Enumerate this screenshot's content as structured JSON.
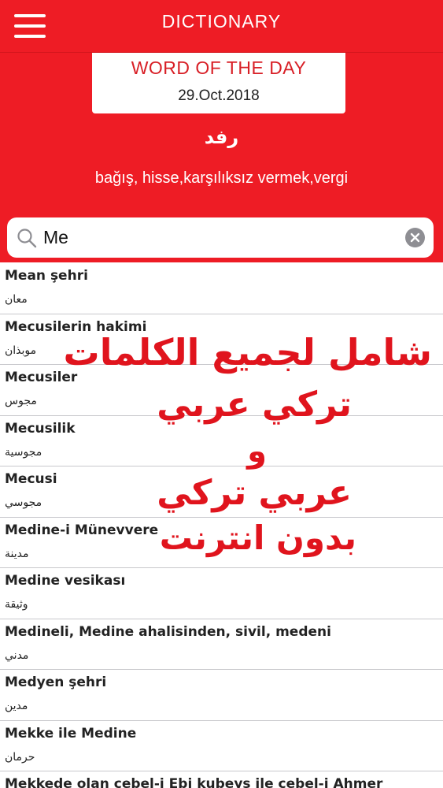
{
  "header": {
    "title": "DICTIONARY",
    "menu_icon": "hamburger-menu-icon",
    "background_color": "#ee1c25"
  },
  "word_of_the_day": {
    "heading": "WORD OF THE DAY",
    "date": "29.Oct.2018",
    "word": "رفد",
    "meaning": "bağış, hisse,karşılıksız vermek,vergi"
  },
  "search": {
    "value": "Me",
    "placeholder": "",
    "search_icon": "search-icon",
    "clear_icon": "clear-icon"
  },
  "results": [
    {
      "term": "Mean şehri",
      "translation": "معان"
    },
    {
      "term": "Mecusilerin hakimi",
      "translation": "موبذان"
    },
    {
      "term": "Mecusiler",
      "translation": "مجوس"
    },
    {
      "term": "Mecusilik",
      "translation": "مجوسية"
    },
    {
      "term": "Mecusi",
      "translation": "مجوسي"
    },
    {
      "term": "Medine-i Münevvere",
      "translation": "مدينة"
    },
    {
      "term": "Medine vesikası",
      "translation": "وثيقة"
    },
    {
      "term": "Medineli, Medine ahalisinden, sivil, medeni",
      "translation": "مدني"
    },
    {
      "term": "Medyen şehri",
      "translation": "مدين"
    },
    {
      "term": "Mekke ile Medine",
      "translation": "حرمان"
    },
    {
      "term": "Mekkede olan cebel-i Ebi kubeys ile cebel-i Ahmer",
      "translation": ""
    }
  ],
  "promo_overlay": {
    "lines": [
      "شامل لجميع الكلمات",
      "تركي عربي",
      "و",
      "عربي تركي",
      "بدون انترنت"
    ],
    "color": "#e0141d"
  }
}
